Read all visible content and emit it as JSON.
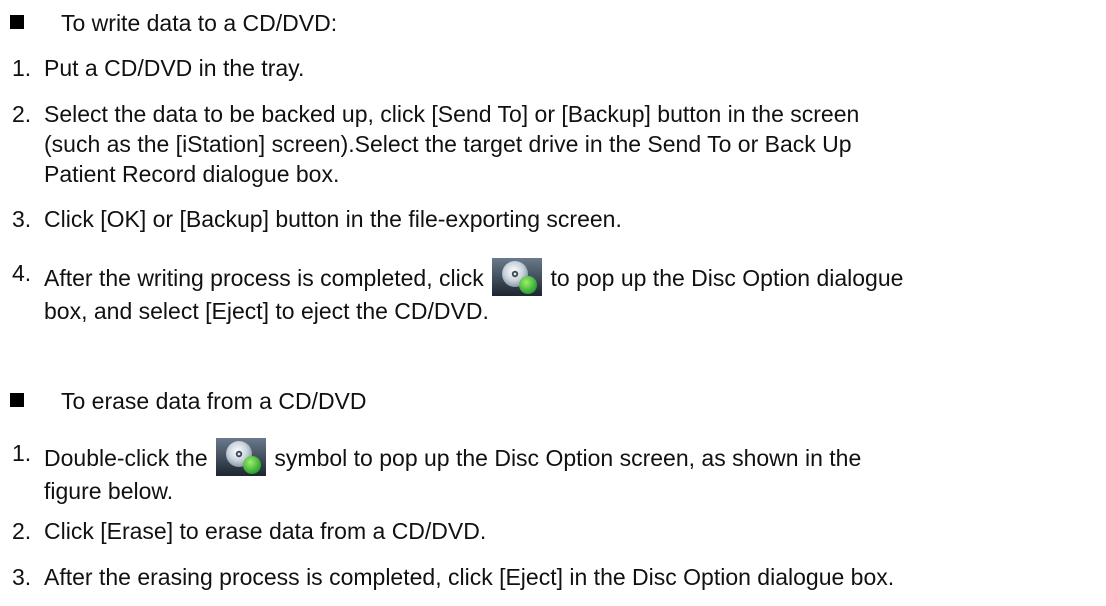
{
  "write_section": {
    "heading": "To write data to a CD/DVD:",
    "steps": [
      {
        "num": "1.",
        "text": "Put a CD/DVD in the tray."
      },
      {
        "num": "2.",
        "lines": [
          "Select the data to be backed up, click [Send To] or [Backup] button in the screen",
          "(such as the [iStation] screen).Select the target drive in the Send To or Back Up",
          "Patient Record dialogue box."
        ]
      },
      {
        "num": "3.",
        "text": "Click [OK] or [Backup] button in the file-exporting screen."
      },
      {
        "num": "4.",
        "before": "After the writing process is completed, click",
        "after": "to pop up the Disc Option dialogue",
        "line2": "box, and select [Eject] to eject the CD/DVD.",
        "icon": "disc-option-icon"
      }
    ]
  },
  "erase_section": {
    "heading": "To erase data from a CD/DVD",
    "steps": [
      {
        "num": "1.",
        "before": "Double-click the",
        "after": "symbol to pop up the Disc Option screen, as shown in the",
        "line2": "figure below.",
        "icon": "disc-option-icon"
      },
      {
        "num": "2.",
        "text": "Click [Erase] to erase data from a CD/DVD."
      },
      {
        "num": "3.",
        "text": "After the erasing process is completed, click [Eject] in the Disc Option dialogue box."
      }
    ]
  }
}
